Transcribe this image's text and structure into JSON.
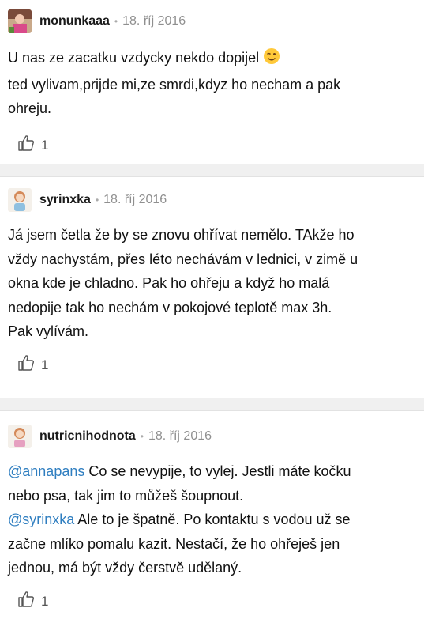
{
  "comments": [
    {
      "author": "monunkaaa",
      "date": "18. říj 2016",
      "lines": [
        "U nas ze zacatku vzdycky nekdo dopijel",
        "ted vylivam,prijde mi,ze smrdi,kdyz ho necham a pak",
        "ohreju."
      ],
      "likes": "1"
    },
    {
      "author": "syrinxka",
      "date": "18. říj 2016",
      "lines": [
        "Já jsem četla že by se znovu ohřívat nemělo. TAkže ho",
        "vždy nachystám, přes léto nechávám v lednici, v zimě u",
        "okna kde je chladno. Pak ho ohřeju a když ho malá",
        "nedopije tak ho nechám v pokojové teplotě max 3h.",
        "Pak vylívám."
      ],
      "likes": "1"
    },
    {
      "author": "nutricnihodnota",
      "date": "18. říj 2016",
      "mention1": "@annapans",
      "line1_rest": " Co se nevypije, to vylej. Jestli máte kočku",
      "line2": "nebo psa, tak jim to můžeš šoupnout.",
      "mention2": "@syrinxka",
      "line3_rest": " Ale to je špatně. Po kontaktu s vodou už se",
      "line4": "začne mlíko pomalu kazit. Nestačí, že ho ohřeješ jen",
      "line5": "jednou, má být vždy čerstvě udělaný.",
      "likes": "1"
    }
  ],
  "colors": {
    "mention": "#2f7ec0",
    "date": "#8f8f8f",
    "separator": "#f0f0f0"
  },
  "icons": [
    "thumbs-up-icon",
    "wink-emoji-icon",
    "avatar"
  ]
}
